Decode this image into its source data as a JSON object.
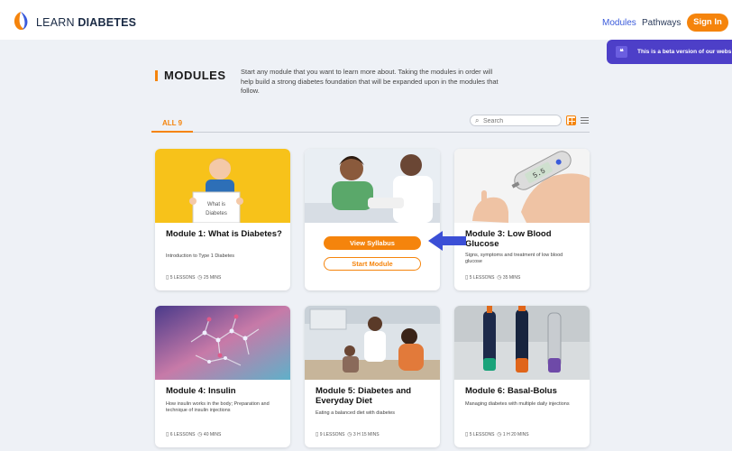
{
  "header": {
    "brand_light": "LEARN",
    "brand_bold": "DIABETES",
    "nav": {
      "modules": "Modules",
      "pathways": "Pathways"
    },
    "signin": "Sign In",
    "colors": {
      "accent": "#f5840c",
      "nav_active": "#3b5bdb"
    }
  },
  "beta_banner": {
    "icon": "chat-icon",
    "text": "This is a beta version of our webs"
  },
  "modules_section": {
    "title": "MODULES",
    "description": "Start any module that you want to learn more about. Taking the modules in order will help build a strong diabetes foundation that will be expanded upon in the modules that follow.",
    "tab_all": "ALL 9",
    "search_placeholder": "Search",
    "view_toggle": {
      "grid_active": true
    }
  },
  "cards": [
    {
      "title": "Module 1: What is Diabetes?",
      "description": "Introduction to Type 1 Diabetes",
      "lessons": "5 LESSONS",
      "duration": "25 MINS",
      "image": "child-holding-sign",
      "sign_text": "What is Diabetes"
    },
    {
      "title": "",
      "description": "",
      "lessons": "",
      "duration": "",
      "image": "doctor-and-child",
      "view_syllabus": "View Syllabus",
      "start_module": "Start Module"
    },
    {
      "title": "Module 3: Low Blood Glucose",
      "description": "Signs, symptoms and treatment of low blood glucose",
      "lessons": "5 LESSONS",
      "duration": "35 MINS",
      "image": "glucose-meter",
      "meter_reading": "5.5"
    },
    {
      "title": "Module 4: Insulin",
      "description": "How insulin works in the body; Preparation and technique of insulin injections",
      "lessons": "6 LESSONS",
      "duration": "40 MINS",
      "image": "insulin-molecule"
    },
    {
      "title": "Module 5: Diabetes and Everyday Diet",
      "description": "Eating a balanced diet with diabetes",
      "lessons": "9 LESSONS",
      "duration": "3 H 15 MINS",
      "image": "family-kitchen"
    },
    {
      "title": "Module 6: Basal-Bolus",
      "description": "Managing diabetes with multiple daily injections",
      "lessons": "5 LESSONS",
      "duration": "1 H 20 MINS",
      "image": "insulin-pens"
    }
  ]
}
